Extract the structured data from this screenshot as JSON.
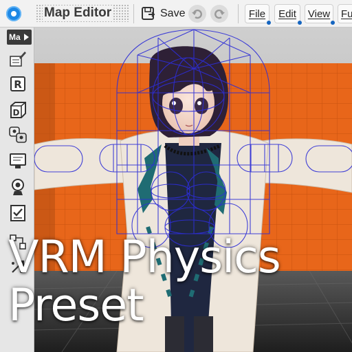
{
  "toolbar": {
    "title": "Map Editor",
    "save_label": "Save",
    "menus": [
      "File",
      "Edit",
      "View",
      "Fu"
    ]
  },
  "sidebar": {
    "top_tab": "Ma",
    "tools": [
      {
        "name": "pencil-doc-tool",
        "icon": "pencil-icon"
      },
      {
        "name": "r-tool",
        "icon": "r-box-icon",
        "letter": "R"
      },
      {
        "name": "d-tool",
        "icon": "d-cube-icon",
        "letter": "D"
      },
      {
        "name": "gamepad-tool",
        "icon": "gamepad-icon"
      },
      {
        "name": "monitor-tool",
        "icon": "monitor-icon"
      },
      {
        "name": "camera-tool",
        "icon": "camera-icon"
      },
      {
        "name": "checklist-tool",
        "icon": "checklist-icon"
      },
      {
        "name": "node-tool",
        "icon": "node-graph-icon"
      },
      {
        "name": "move-tool",
        "icon": "arrows-icon"
      }
    ]
  },
  "caption": {
    "line1": "VRM Physics",
    "line2": "Preset"
  },
  "colors": {
    "accent": "#1e88e5",
    "wall": "#e8661a",
    "wireframe": "#2d2dd6",
    "hair": "#2e2036",
    "sweater": "#eee6db",
    "ribbon": "#1f6c73"
  }
}
